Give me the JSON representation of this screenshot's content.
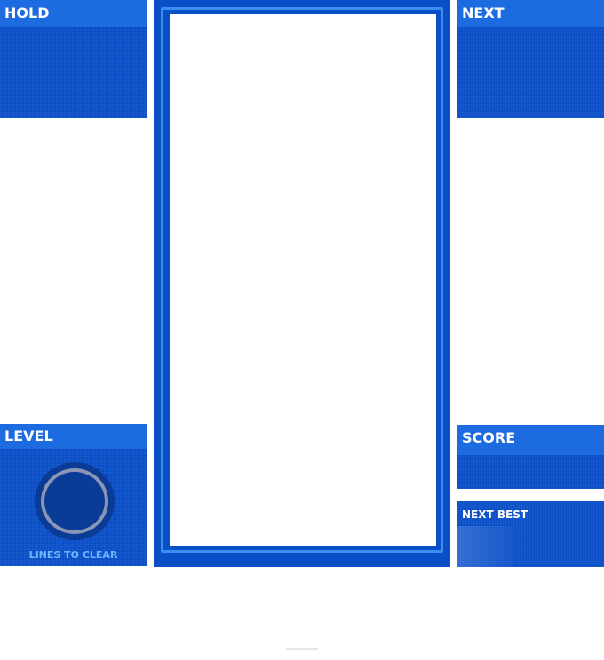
{
  "hold": {
    "title": "HOLD"
  },
  "next": {
    "title": "NEXT"
  },
  "level": {
    "title": "LEVEL",
    "lines_label": "LINES TO CLEAR"
  },
  "score": {
    "title": "SCORE"
  },
  "next_best": {
    "title": "NEXT BEST"
  },
  "colors": {
    "panel": "#0b4fc7",
    "header": "#1d6be0",
    "lines_text": "#6fb6ff"
  }
}
